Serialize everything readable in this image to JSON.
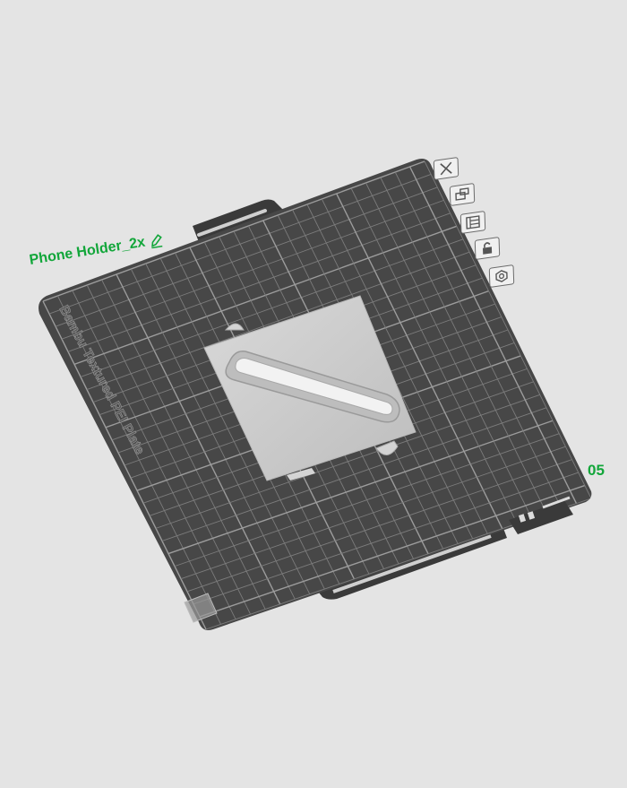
{
  "plate": {
    "name": "Phone Holder_2x",
    "number": "05",
    "brand_text": "Bambu Textured PEI Plate"
  },
  "toolbar": {
    "buttons": [
      {
        "name": "close-plate",
        "icon": "close-icon"
      },
      {
        "name": "arrange",
        "icon": "arrange-icon"
      },
      {
        "name": "orient",
        "icon": "layout-icon"
      },
      {
        "name": "lock",
        "icon": "lock-icon"
      },
      {
        "name": "settings",
        "icon": "settings-icon"
      }
    ]
  },
  "colors": {
    "background": "#e4e4e4",
    "plate": "#4a4a4a",
    "grid": "#8a8a8a",
    "accent": "#12a63a",
    "model": "#cfcfcf"
  }
}
